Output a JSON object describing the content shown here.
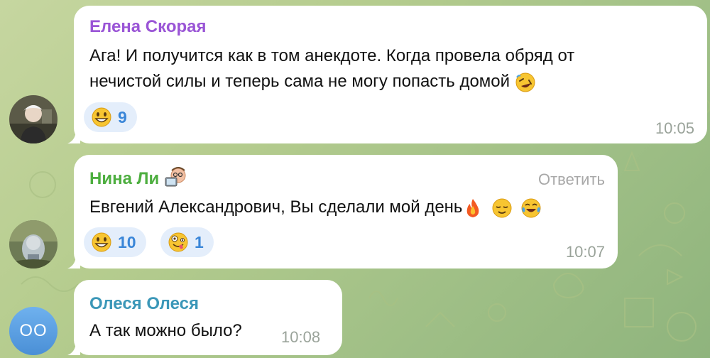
{
  "colors": {
    "name_elena": "#9a55d6",
    "name_nina": "#4dae3f",
    "name_olesya": "#3b97b8",
    "reaction_bg": "#e4eefb",
    "reaction_count": "#3a86d8"
  },
  "messages": [
    {
      "sender": "Елена Скорая",
      "lines": [
        "Ага! И получится как в том анекдоте. Когда провела обряд от",
        "нечистой силы и теперь сама не могу попасть домой"
      ],
      "trailing_emoji": "rolling-on-floor-laughing",
      "reactions": [
        {
          "emoji": "grinning-face",
          "count": "9"
        }
      ],
      "time": "10:05"
    },
    {
      "sender": "Нина Ли",
      "sender_badge": "person-at-computer-emoji",
      "reply_label": "Ответить",
      "text": "Евгений Александрович, Вы сделали мой день",
      "trailing_emojis": [
        "fire",
        "relieved-face",
        "tears-of-joy"
      ],
      "reactions": [
        {
          "emoji": "grinning-face",
          "count": "10"
        },
        {
          "emoji": "zany-face",
          "count": "1"
        }
      ],
      "time": "10:07"
    },
    {
      "sender": "Олеся Олеся",
      "avatar_initials": "OO",
      "text": "А так можно было?",
      "time": "10:08"
    }
  ]
}
